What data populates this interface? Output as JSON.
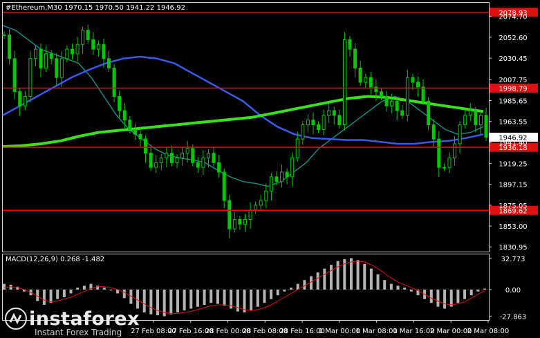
{
  "header": {
    "symbol": "#Ethereum,M30",
    "ohlc": "1970.15 1970.50 1941.22 1946.92"
  },
  "macd_header": "MACD(12,26,9) 0.268 -1.482",
  "watermark": {
    "name": "instaforex",
    "sub": "Instant Forex Trading"
  },
  "colors": {
    "background": "#000000",
    "candles": "#00c800",
    "level_line": "#ff0000",
    "level_label_bg": "#e01010",
    "ma_fast": "#138b83",
    "ma_mid": "#3a5be8",
    "ma_slow": "#39e01c",
    "macd_hist": "#b4b4b4",
    "macd_signal": "#e01010",
    "current_price_bg": "#ffffff"
  },
  "chart_data": {
    "type": "candlestick",
    "symbol": "#Ethereum",
    "timeframe": "M30",
    "price_ticks": [
      "2074.70",
      "2052.60",
      "2030.45",
      "2007.75",
      "1985.65",
      "1963.55",
      "1941.40",
      "1919.25",
      "1897.15",
      "1875.05",
      "1853.00",
      "1830.95"
    ],
    "time_ticks": [
      "27 Feb 08:00",
      "27 Feb 16:00",
      "28 Feb 00:00",
      "28 Feb 08:00",
      "28 Feb 16:00",
      "1 Mar 00:00",
      "1 Mar 08:00",
      "1 Mar 16:00",
      "2 Mar 00:00",
      "2 Mar 08:00"
    ],
    "ylim": [
      1826,
      2089
    ],
    "levels": [
      {
        "price": 2078.93,
        "label": "2078.93"
      },
      {
        "price": 1998.79,
        "label": "1998.79"
      },
      {
        "price": 1936.18,
        "label": "1936.18"
      },
      {
        "price": 1869.62,
        "label": "1869.62"
      }
    ],
    "current_price": {
      "price": 1946.92,
      "label": "1946.92"
    },
    "close_series": [
      2055,
      2030,
      1995,
      1980,
      1990,
      2030,
      2040,
      2020,
      2035,
      2030,
      2010,
      2030,
      2040,
      2035,
      2045,
      2060,
      2050,
      2040,
      2045,
      2030,
      2020,
      1990,
      1975,
      1965,
      1955,
      1950,
      1945,
      1930,
      1915,
      1920,
      1925,
      1930,
      1920,
      1925,
      1930,
      1935,
      1920,
      1915,
      1925,
      1930,
      1920,
      1910,
      1880,
      1850,
      1860,
      1855,
      1860,
      1870,
      1875,
      1880,
      1890,
      1905,
      1900,
      1910,
      1905,
      1925,
      1945,
      1960,
      1965,
      1960,
      1955,
      1970,
      1975,
      1970,
      1960,
      2050,
      2040,
      2020,
      2005,
      2010,
      2000,
      1995,
      1990,
      1980,
      1985,
      1975,
      1970,
      2010,
      2005,
      2000,
      1985,
      1960,
      1945,
      1915,
      1915,
      1925,
      1940,
      1960,
      1970,
      1975,
      1960,
      1970,
      1946.92
    ],
    "ma_fast_series": [
      2065,
      2060,
      2050,
      2040,
      2035,
      2030,
      2025,
      2010,
      1990,
      1970,
      1955,
      1945,
      1935,
      1928,
      1925,
      1923,
      1920,
      1912,
      1905,
      1900,
      1898,
      1895,
      1900,
      1910,
      1920,
      1935,
      1945,
      1955,
      1965,
      1975,
      1985,
      1990,
      1985,
      1975,
      1965,
      1955,
      1950,
      1952,
      1958
    ],
    "ma_mid_series": [
      1970,
      1980,
      1990,
      2000,
      2010,
      2018,
      2025,
      2030,
      2032,
      2030,
      2025,
      2015,
      2005,
      1995,
      1985,
      1970,
      1958,
      1950,
      1946,
      1945,
      1944,
      1944,
      1942,
      1940,
      1940,
      1942,
      1943,
      1946,
      1950
    ],
    "ma_slow_series": [
      1937,
      1938,
      1940,
      1943,
      1948,
      1952,
      1954,
      1956,
      1958,
      1960,
      1962,
      1964,
      1966,
      1968,
      1972,
      1976,
      1980,
      1984,
      1988,
      1990,
      1989,
      1986,
      1983,
      1980,
      1977,
      1974
    ],
    "macd": {
      "ylim": [
        -32,
        37
      ],
      "ticks": [
        "32.773",
        "0.00",
        "-27.863"
      ],
      "histogram": [
        6,
        5,
        3,
        -2,
        -6,
        -12,
        -16,
        -14,
        -10,
        -8,
        -4,
        2,
        4,
        6,
        4,
        2,
        -1,
        -4,
        -9,
        -15,
        -20,
        -24,
        -26,
        -27,
        -28,
        -26,
        -24,
        -22,
        -20,
        -18,
        -16,
        -14,
        -15,
        -17,
        -20,
        -23,
        -24,
        -22,
        -18,
        -14,
        -10,
        -6,
        -2,
        2,
        6,
        10,
        14,
        18,
        22,
        26,
        30,
        32,
        33,
        31,
        27,
        22,
        16,
        10,
        6,
        4,
        2,
        -2,
        -6,
        -10,
        -14,
        -18,
        -20,
        -18,
        -14,
        -10,
        -6,
        -2,
        1
      ],
      "signal": [
        2,
        3,
        2,
        0,
        -3,
        -7,
        -11,
        -13,
        -12,
        -10,
        -8,
        -5,
        -2,
        1,
        3,
        3,
        2,
        0,
        -3,
        -7,
        -11,
        -15,
        -19,
        -22,
        -24,
        -25,
        -25,
        -24,
        -23,
        -21,
        -19,
        -17,
        -16,
        -16,
        -17,
        -19,
        -21,
        -22,
        -21,
        -19,
        -16,
        -12,
        -8,
        -4,
        0,
        4,
        8,
        12,
        16,
        20,
        24,
        27,
        29,
        30,
        29,
        26,
        22,
        17,
        12,
        8,
        5,
        2,
        -1,
        -5,
        -9,
        -12,
        -15,
        -16,
        -15,
        -13,
        -9,
        -5,
        -1
      ]
    }
  }
}
